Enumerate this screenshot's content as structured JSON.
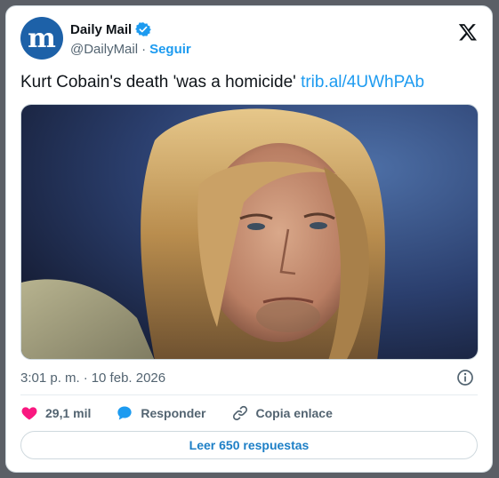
{
  "author": {
    "display_name": "Daily Mail",
    "handle": "@DailyMail",
    "separator": "·",
    "follow_label": "Seguir",
    "avatar_letter": "m",
    "brand_color": "#1d61a8",
    "verified_icon": "verified-badge-icon"
  },
  "tweet": {
    "text": "Kurt Cobain's death 'was a homicide'",
    "link": "trib.al/4UWhPAb"
  },
  "meta": {
    "time": "3:01 p. m.",
    "separator": "·",
    "date": "10 feb. 2026"
  },
  "actions": {
    "likes_count": "29,1 mil",
    "reply_label": "Responder",
    "copy_link_label": "Copia enlace"
  },
  "replies_button": {
    "label": "Leer 650 respuestas"
  },
  "colors": {
    "accent": "#1d9bf0",
    "heart": "#f91880",
    "text_secondary": "#536471"
  }
}
